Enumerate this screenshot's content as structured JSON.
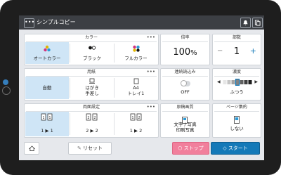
{
  "topbar": {
    "menu_label": "•••",
    "title": "シンプルコピー"
  },
  "color": {
    "header": "カラー",
    "more": "•••",
    "options": [
      {
        "label": "オートカラー",
        "selected": true
      },
      {
        "label": "ブラック",
        "selected": false
      },
      {
        "label": "フルカラー",
        "selected": false
      }
    ]
  },
  "ratio": {
    "header": "倍率",
    "value": "100",
    "unit": "%"
  },
  "copies": {
    "header": "部数",
    "value": "1",
    "minus": "−",
    "plus": "+"
  },
  "paper": {
    "header": "用紙",
    "more": "•••",
    "options": [
      {
        "label": "自動",
        "selected": true
      },
      {
        "line1": "はがき",
        "line2": "手差し",
        "selected": false
      },
      {
        "line1": "A4",
        "line2": "トレイ1",
        "selected": false
      }
    ]
  },
  "continuous": {
    "header": "連続読込み",
    "state": "OFF"
  },
  "density": {
    "header": "濃度",
    "value": "ふつう",
    "level": 4,
    "steps": 7
  },
  "duplex": {
    "header": "両面設定",
    "more": "•••",
    "options": [
      {
        "label": "1 ▶ 1",
        "selected": true
      },
      {
        "label": "2 ▶ 2",
        "selected": false
      },
      {
        "label": "1 ▶ 2",
        "selected": false
      }
    ]
  },
  "quality": {
    "header": "原稿画質",
    "line1": "文字 / 写真",
    "line2": "印刷写真"
  },
  "combine": {
    "header": "ページ集約",
    "value": "しない"
  },
  "bottom": {
    "reset": "リセット",
    "stop": "ストップ",
    "start": "スタート"
  },
  "colors": {
    "accent": "#1479b8",
    "stop": "#f17f9c",
    "selected": "#cfe5f6"
  }
}
